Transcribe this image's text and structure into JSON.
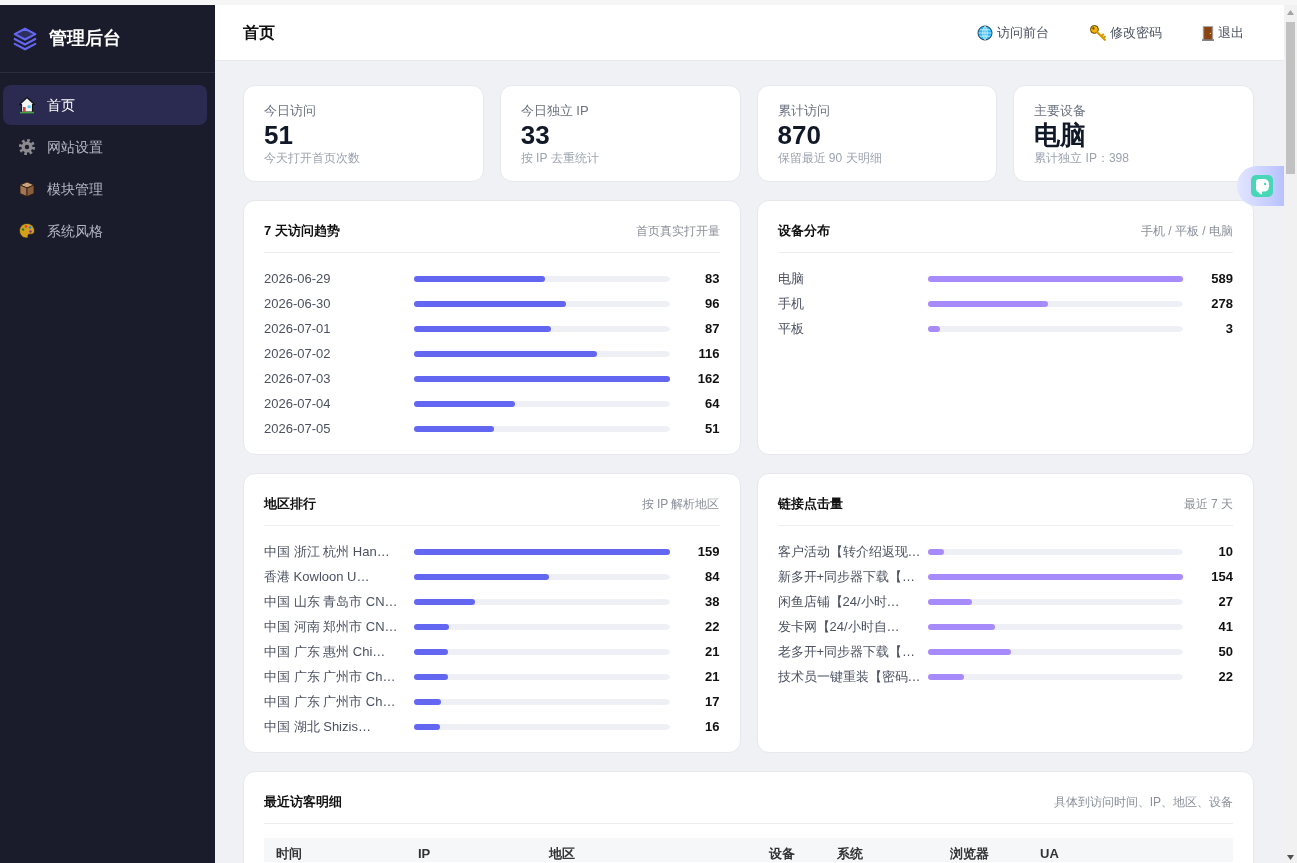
{
  "sidebar": {
    "brand": "管理后台",
    "items": [
      {
        "label": "首页",
        "selected": true
      },
      {
        "label": "网站设置",
        "selected": false
      },
      {
        "label": "模块管理",
        "selected": false
      },
      {
        "label": "系统风格",
        "selected": false
      }
    ]
  },
  "header": {
    "title": "首页",
    "links": [
      {
        "label": "访问前台"
      },
      {
        "label": "修改密码"
      },
      {
        "label": "退出"
      }
    ]
  },
  "stats": [
    {
      "label": "今日访问",
      "value": "51",
      "note": "今天打开首页次数"
    },
    {
      "label": "今日独立 IP",
      "value": "33",
      "note": "按 IP 去重统计"
    },
    {
      "label": "累计访问",
      "value": "870",
      "note": "保留最近 90 天明细"
    },
    {
      "label": "主要设备",
      "value": "电脑",
      "note": "累计独立 IP：398"
    }
  ],
  "panels": [
    {
      "title": "7 天访问趋势",
      "subtitle": "首页真实打开量",
      "color": "#6366f1",
      "rows": [
        {
          "label": "2026-06-29",
          "value": "83",
          "level": 0.512
        },
        {
          "label": "2026-06-30",
          "value": "96",
          "level": 0.593
        },
        {
          "label": "2026-07-01",
          "value": "87",
          "level": 0.537
        },
        {
          "label": "2026-07-02",
          "value": "116",
          "level": 0.716
        },
        {
          "label": "2026-07-03",
          "value": "162",
          "level": 1
        },
        {
          "label": "2026-07-04",
          "value": "64",
          "level": 0.395
        },
        {
          "label": "2026-07-05",
          "value": "51",
          "level": 0.315
        }
      ]
    },
    {
      "title": "设备分布",
      "subtitle": "手机 / 平板 / 电脑",
      "color": "#a78bfa",
      "rows": [
        {
          "label": "电脑",
          "value": "589",
          "level": 1
        },
        {
          "label": "手机",
          "value": "278",
          "level": 0.472
        },
        {
          "label": "平板",
          "value": "3",
          "level": 0.05
        }
      ]
    },
    {
      "title": "地区排行",
      "subtitle": "按 IP 解析地区",
      "color": "#6366f1",
      "rows": [
        {
          "label": "中国 浙江 杭州 Han…",
          "value": "159",
          "level": 1
        },
        {
          "label": "香港 Kowloon U…",
          "value": "84",
          "level": 0.528
        },
        {
          "label": "中国 山东 青岛市 CN…",
          "value": "38",
          "level": 0.239
        },
        {
          "label": "中国 河南 郑州市 CN…",
          "value": "22",
          "level": 0.138
        },
        {
          "label": "中国 广东 惠州 Chi…",
          "value": "21",
          "level": 0.132
        },
        {
          "label": "中国 广东 广州市 Ch…",
          "value": "21",
          "level": 0.132
        },
        {
          "label": "中国 广东 广州市 Ch…",
          "value": "17",
          "level": 0.107
        },
        {
          "label": "中国 湖北 Shizis…",
          "value": "16",
          "level": 0.101
        }
      ]
    },
    {
      "title": "链接点击量",
      "subtitle": "最近 7 天",
      "color": "#a78bfa",
      "rows": [
        {
          "label": "客户活动【转介绍返现…",
          "value": "10",
          "level": 0.065
        },
        {
          "label": "新多开+同步器下载【…",
          "value": "154",
          "level": 1
        },
        {
          "label": "闲鱼店铺【24/小时…",
          "value": "27",
          "level": 0.175
        },
        {
          "label": "发卡网【24/小时自…",
          "value": "41",
          "level": 0.266
        },
        {
          "label": "老多开+同步器下载【…",
          "value": "50",
          "level": 0.325
        },
        {
          "label": "技术员一键重装【密码…",
          "value": "22",
          "level": 0.143
        }
      ]
    }
  ],
  "visitor_table": {
    "title": "最近访客明细",
    "subtitle": "具体到访问时间、IP、地区、设备",
    "columns": [
      "时间",
      "IP",
      "地区",
      "设备",
      "系统",
      "浏览器",
      "UA"
    ]
  }
}
